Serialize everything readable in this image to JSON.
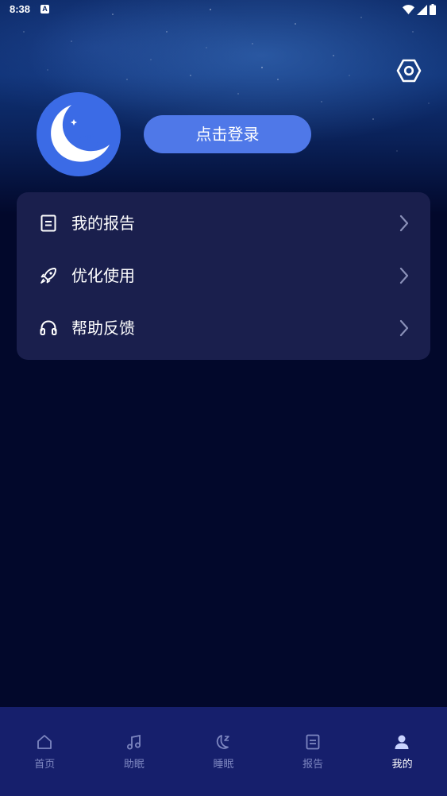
{
  "status_bar": {
    "time": "8:38",
    "notification_icon": "A",
    "icons": [
      "wifi-icon",
      "signal-icon",
      "battery-icon"
    ]
  },
  "header": {
    "settings_icon": "settings-hexagon-icon",
    "avatar_icon": "moon-squirrel-logo",
    "login_label": "点击登录"
  },
  "menu": {
    "items": [
      {
        "label": "我的报告",
        "icon": "document-icon"
      },
      {
        "label": "优化使用",
        "icon": "rocket-icon"
      },
      {
        "label": "帮助反馈",
        "icon": "headphones-icon"
      }
    ]
  },
  "tabbar": {
    "tabs": [
      {
        "label": "首页",
        "icon": "home-icon"
      },
      {
        "label": "助眠",
        "icon": "music-note-icon"
      },
      {
        "label": "睡眠",
        "icon": "moon-zzz-icon"
      },
      {
        "label": "报告",
        "icon": "document-icon"
      },
      {
        "label": "我的",
        "icon": "person-icon"
      }
    ],
    "active": "我的"
  },
  "colors": {
    "background": "#02082b",
    "card": "#1a1f4d",
    "accent": "#4f78e8",
    "tabbar": "#161f6c",
    "tab_inactive": "#7d86c0"
  }
}
